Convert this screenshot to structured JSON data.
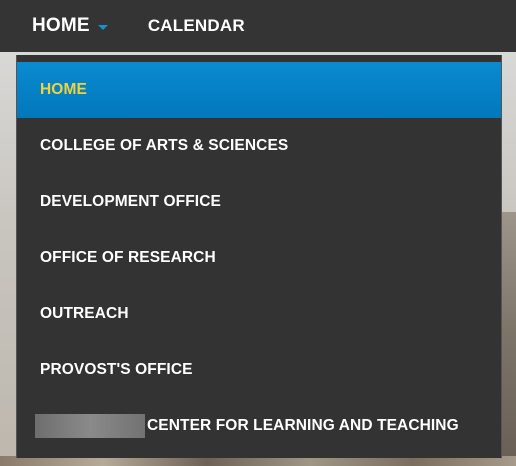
{
  "top_nav": {
    "home_label": "HOME",
    "calendar_label": "CALENDAR"
  },
  "dropdown": {
    "items": [
      {
        "label": "HOME",
        "active": true
      },
      {
        "label": "COLLEGE OF ARTS & SCIENCES",
        "active": false
      },
      {
        "label": "DEVELOPMENT OFFICE",
        "active": false
      },
      {
        "label": "OFFICE OF RESEARCH",
        "active": false
      },
      {
        "label": "OUTREACH",
        "active": false
      },
      {
        "label": "PROVOST'S OFFICE",
        "active": false
      },
      {
        "label": "CENTER FOR LEARNING AND TEACHING",
        "active": false
      }
    ]
  },
  "colors": {
    "nav_bg": "#343434",
    "menu_bg": "#333333",
    "active_bg": "#0277bc",
    "active_text": "#f2d33b",
    "caret": "#1a8fd0"
  },
  "icons": {
    "home_dropdown": "chevron-down-icon"
  }
}
